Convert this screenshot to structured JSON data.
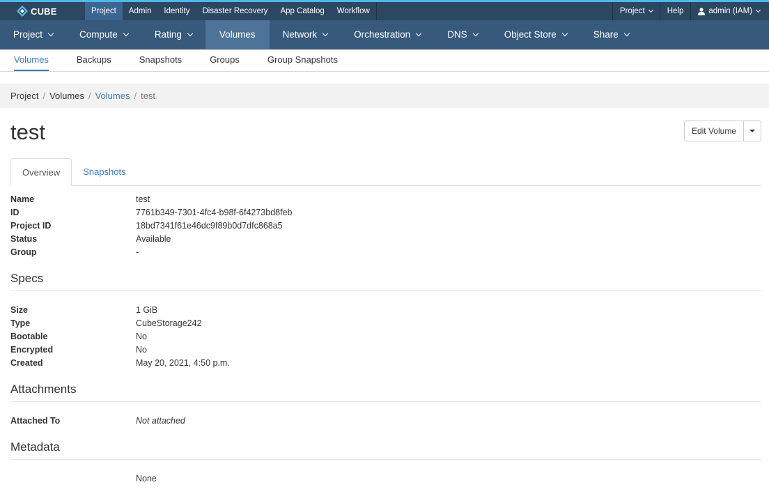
{
  "brand": {
    "name": "CUBE"
  },
  "topnav": {
    "items": [
      "Project",
      "Admin",
      "Identity",
      "Disaster Recovery",
      "App Catalog",
      "Workflow"
    ],
    "right": {
      "project": "Project",
      "help": "Help",
      "user": "admin (IAM)"
    }
  },
  "mainnav": {
    "items": [
      "Project",
      "Compute",
      "Rating",
      "Volumes",
      "Network",
      "Orchestration",
      "DNS",
      "Object Store",
      "Share"
    ]
  },
  "subnav": {
    "items": [
      "Volumes",
      "Backups",
      "Snapshots",
      "Groups",
      "Group Snapshots"
    ]
  },
  "breadcrumb": [
    "Project",
    "Volumes",
    "Volumes",
    "test"
  ],
  "page": {
    "title": "test",
    "edit_label": "Edit Volume"
  },
  "tabs": [
    "Overview",
    "Snapshots"
  ],
  "overview": {
    "name": {
      "label": "Name",
      "value": "test"
    },
    "id": {
      "label": "ID",
      "value": "7761b349-7301-4fc4-b98f-6f4273bd8feb"
    },
    "project_id": {
      "label": "Project ID",
      "value": "18bd7341f61e46dc9f89b0d7dfc868a5"
    },
    "status": {
      "label": "Status",
      "value": "Available"
    },
    "group": {
      "label": "Group",
      "value": "-"
    }
  },
  "specs": {
    "title": "Specs",
    "size": {
      "label": "Size",
      "value": "1 GiB"
    },
    "type": {
      "label": "Type",
      "value": "CubeStorage242"
    },
    "bootable": {
      "label": "Bootable",
      "value": "No"
    },
    "encrypted": {
      "label": "Encrypted",
      "value": "No"
    },
    "created": {
      "label": "Created",
      "value": "May 20, 2021, 4:50 p.m."
    }
  },
  "attachments": {
    "title": "Attachments",
    "attached_to": {
      "label": "Attached To",
      "value": "Not attached"
    }
  },
  "metadata": {
    "title": "Metadata",
    "value": "None"
  },
  "colors": {
    "topbar": "#2b4762",
    "mainnav": "#36597c",
    "accent": "#3b79c3"
  }
}
